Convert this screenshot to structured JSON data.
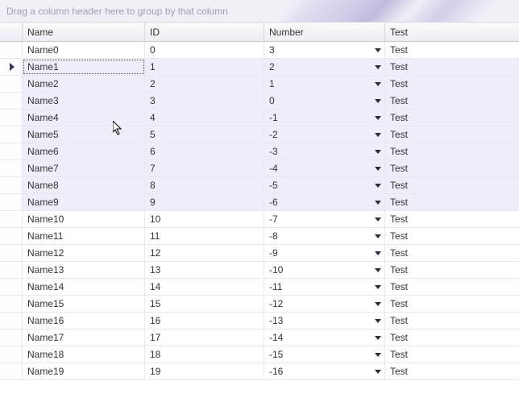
{
  "grouppanel_text": "Drag a column header here to group by that column",
  "columns": {
    "name": "Name",
    "id": "ID",
    "number": "Number",
    "test": "Test"
  },
  "band_start": 1,
  "band_end": 9,
  "selected_index": 1,
  "rows": [
    {
      "name": "Name0",
      "id": "0",
      "number": "3",
      "test": "Test"
    },
    {
      "name": "Name1",
      "id": "1",
      "number": "2",
      "test": "Test"
    },
    {
      "name": "Name2",
      "id": "2",
      "number": "1",
      "test": "Test"
    },
    {
      "name": "Name3",
      "id": "3",
      "number": "0",
      "test": "Test"
    },
    {
      "name": "Name4",
      "id": "4",
      "number": "-1",
      "test": "Test"
    },
    {
      "name": "Name5",
      "id": "5",
      "number": "-2",
      "test": "Test"
    },
    {
      "name": "Name6",
      "id": "6",
      "number": "-3",
      "test": "Test"
    },
    {
      "name": "Name7",
      "id": "7",
      "number": "-4",
      "test": "Test"
    },
    {
      "name": "Name8",
      "id": "8",
      "number": "-5",
      "test": "Test"
    },
    {
      "name": "Name9",
      "id": "9",
      "number": "-6",
      "test": "Test"
    },
    {
      "name": "Name10",
      "id": "10",
      "number": "-7",
      "test": "Test"
    },
    {
      "name": "Name11",
      "id": "11",
      "number": "-8",
      "test": "Test"
    },
    {
      "name": "Name12",
      "id": "12",
      "number": "-9",
      "test": "Test"
    },
    {
      "name": "Name13",
      "id": "13",
      "number": "-10",
      "test": "Test"
    },
    {
      "name": "Name14",
      "id": "14",
      "number": "-11",
      "test": "Test"
    },
    {
      "name": "Name15",
      "id": "15",
      "number": "-12",
      "test": "Test"
    },
    {
      "name": "Name16",
      "id": "16",
      "number": "-13",
      "test": "Test"
    },
    {
      "name": "Name17",
      "id": "17",
      "number": "-14",
      "test": "Test"
    },
    {
      "name": "Name18",
      "id": "18",
      "number": "-15",
      "test": "Test"
    },
    {
      "name": "Name19",
      "id": "19",
      "number": "-16",
      "test": "Test"
    }
  ]
}
